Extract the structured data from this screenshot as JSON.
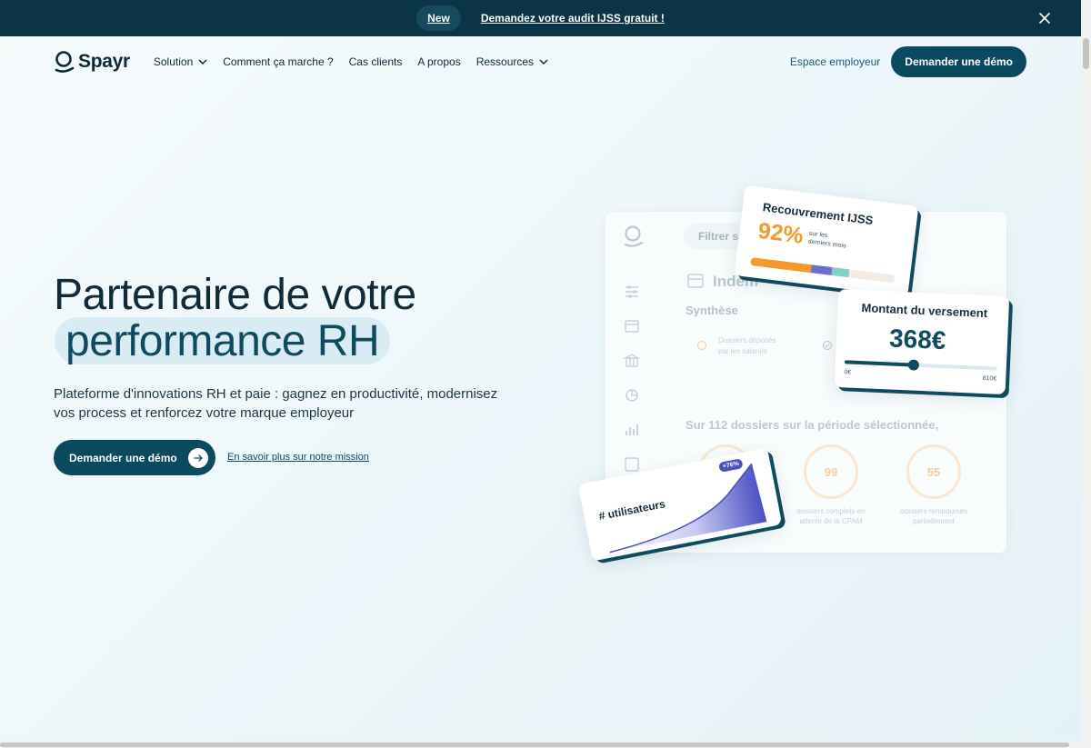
{
  "announcement": {
    "badge": "New",
    "link": "Demandez votre audit IJSS gratuit !"
  },
  "nav": {
    "brand": "Spayr",
    "items": [
      {
        "label": "Solution",
        "dropdown": true
      },
      {
        "label": "Comment ça marche ?",
        "dropdown": false
      },
      {
        "label": "Cas clients",
        "dropdown": false
      },
      {
        "label": "A propos",
        "dropdown": false
      },
      {
        "label": "Ressources",
        "dropdown": true
      }
    ],
    "employer_link": "Espace employeur",
    "demo_button": "Demander une démo"
  },
  "hero": {
    "title_line1": "Partenaire de votre",
    "title_line2": "performance RH",
    "subtitle": "Plateforme d'innovations RH et paie : gagnez en productivité, modernisez vos process et renforcez votre marque employeur",
    "cta": "Demander une démo",
    "link": "En savoir plus sur notre mission"
  },
  "dashboard": {
    "filter_placeholder": "Filtrer su",
    "section_title": "Indem",
    "synthese": "Synthèse",
    "stat1_line1": "Dossiers déposés",
    "stat1_line2": "par les salariés",
    "summary": "Sur 112 dossiers sur la période sélectionnée,",
    "rings": [
      {
        "value": "99",
        "label_line1": "dossiers complets en",
        "label_line2": "attente de la CPAM"
      },
      {
        "value": "55",
        "label_line1": "dossiers remboursés",
        "label_line2": "partiellement"
      }
    ]
  },
  "card_ijss": {
    "title": "Recouvrement IJSS",
    "value": "92%",
    "note_line1": "sur les",
    "note_line2": "derniers mois",
    "segments": [
      {
        "color": "#f39b2a",
        "share": 0.42
      },
      {
        "color": "#6d6fc9",
        "share": 0.14
      },
      {
        "color": "#7fd0c8",
        "share": 0.12
      }
    ]
  },
  "card_montant": {
    "title": "Montant du versement",
    "amount": "368€",
    "min": "0€",
    "max": "810€",
    "fraction": 0.45
  },
  "card_users": {
    "title": "# utilisateurs",
    "badge": "+76%"
  },
  "colors": {
    "primary": "#0b4a5e",
    "topbar": "#0b3447",
    "accent_orange": "#f39b2a",
    "accent_purple": "#4a4fc2"
  }
}
